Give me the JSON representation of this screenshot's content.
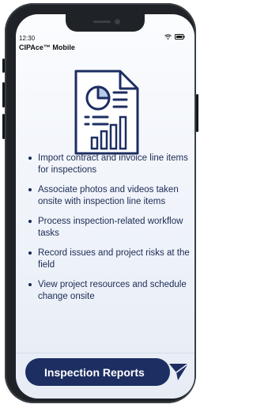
{
  "status": {
    "time": "12:30"
  },
  "app": {
    "title": "CIPAce™ Mobile"
  },
  "features": [
    "Import contract and invoice line items for inspections",
    "Associate photos and videos taken onsite with inspection line items",
    "Process inspection-related workflow tasks",
    "Record issues and project risks at the field",
    "View project resources and schedule change onsite"
  ],
  "cta": {
    "label": "Inspection Reports"
  },
  "colors": {
    "brand_navy": "#1c2e62",
    "text_navy": "#1b2b54"
  },
  "icons": [
    "wifi-icon",
    "battery-icon",
    "report-document-icon",
    "send-icon"
  ]
}
